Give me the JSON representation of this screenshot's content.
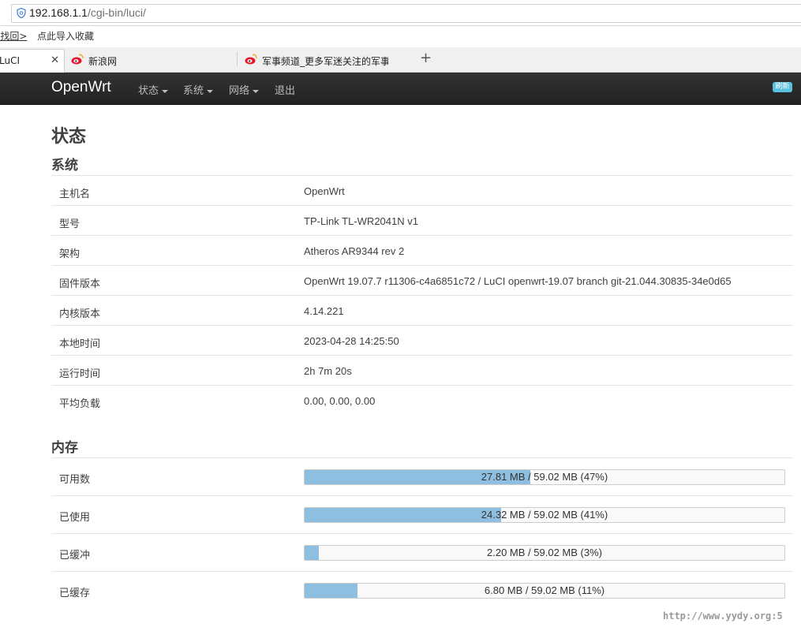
{
  "browser": {
    "url_host": "192.168.1.1",
    "url_path": "/cgi-bin/luci/",
    "bookmarks": [
      "j找回>",
      "点此导入收藏"
    ],
    "tabs": [
      {
        "title": "LuCI",
        "close": "✕"
      },
      {
        "title": "新浪网"
      },
      {
        "title": "军事频道_更多军迷关注的军事"
      }
    ],
    "new_tab": "+"
  },
  "nav": {
    "brand": "OpenWrt",
    "items": [
      "状态",
      "系统",
      "网络",
      "退出"
    ],
    "badge": "刷新"
  },
  "page": {
    "title": "状态",
    "system": {
      "heading": "系统",
      "rows": [
        {
          "label": "主机名",
          "value": "OpenWrt"
        },
        {
          "label": "型号",
          "value": "TP-Link TL-WR2041N v1"
        },
        {
          "label": "架构",
          "value": "Atheros AR9344 rev 2"
        },
        {
          "label": "固件版本",
          "value": "OpenWrt 19.07.7 r11306-c4a6851c72 / LuCI openwrt-19.07 branch git-21.044.30835-34e0d65"
        },
        {
          "label": "内核版本",
          "value": "4.14.221"
        },
        {
          "label": "本地时间",
          "value": "2023-04-28 14:25:50"
        },
        {
          "label": "运行时间",
          "value": "2h 7m 20s"
        },
        {
          "label": "平均负载",
          "value": "0.00, 0.00, 0.00"
        }
      ]
    },
    "memory": {
      "heading": "内存",
      "rows": [
        {
          "label": "可用数",
          "text": "27.81 MB / 59.02 MB (47%)",
          "percent": 47
        },
        {
          "label": "已使用",
          "text": "24.32 MB / 59.02 MB (41%)",
          "percent": 41
        },
        {
          "label": "已缓冲",
          "text": "2.20 MB / 59.02 MB (3%)",
          "percent": 3
        },
        {
          "label": "已缓存",
          "text": "6.80 MB / 59.02 MB (11%)",
          "percent": 11
        }
      ]
    }
  },
  "watermark": "http://www.yydy.org:5",
  "colors": {
    "navbar": "#222222",
    "bar_fill": "#8fbfe0",
    "badge": "#5bc0de"
  }
}
